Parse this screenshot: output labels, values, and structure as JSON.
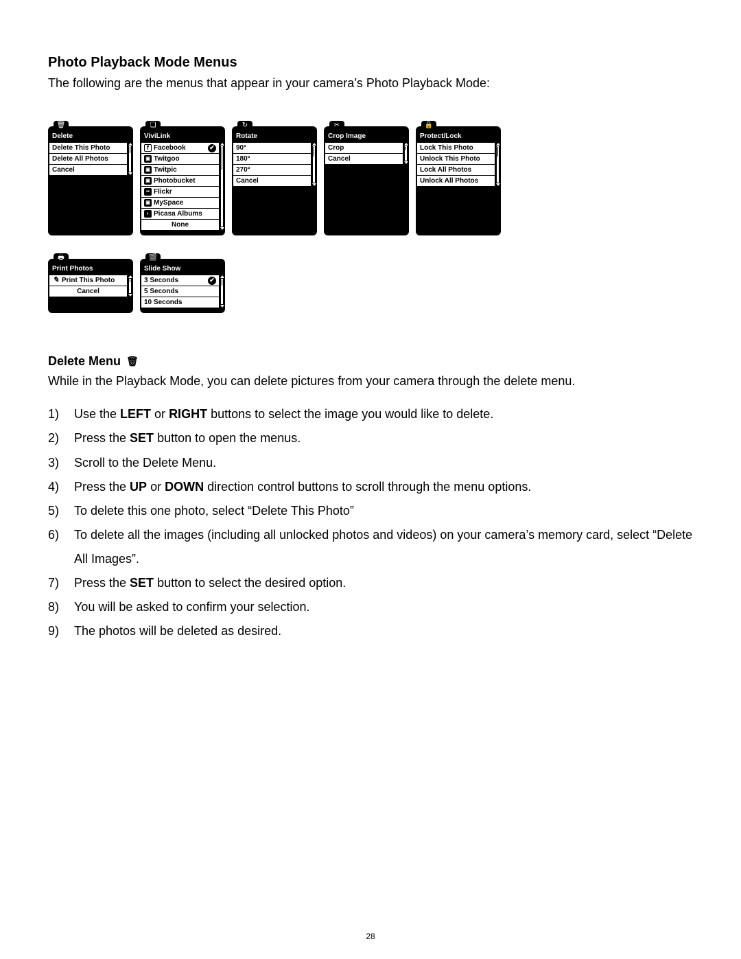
{
  "title": "Photo Playback Mode Menus",
  "intro": "The following are the menus that appear in your camera’s Photo Playback Mode:",
  "menus": {
    "delete": {
      "header": "Delete",
      "items": [
        "Delete This Photo",
        "Delete All Photos",
        "Cancel"
      ]
    },
    "vivilink": {
      "header": "ViviLink",
      "items": [
        "Facebook",
        "Twitgoo",
        "Twitpic",
        "Photobucket",
        "Flickr",
        "MySpace",
        "Picasa Albums",
        "None"
      ],
      "checked_index": 0
    },
    "rotate": {
      "header": "Rotate",
      "items": [
        "90°",
        "180°",
        "270°",
        "Cancel"
      ]
    },
    "crop": {
      "header": "Crop Image",
      "items": [
        "Crop",
        "Cancel"
      ]
    },
    "protect": {
      "header": "Protect/Lock",
      "items": [
        "Lock This Photo",
        "Unlock This Photo",
        "Lock All Photos",
        "Unlock All Photos"
      ]
    },
    "print": {
      "header": "Print Photos",
      "items": [
        "Print This Photo",
        "Cancel"
      ]
    },
    "slideshow": {
      "header": "Slide Show",
      "items": [
        "3 Seconds",
        "5 Seconds",
        "10 Seconds"
      ],
      "checked_index": 0
    }
  },
  "section": {
    "title": "Delete Menu",
    "desc": "While in the Playback Mode, you can delete pictures from your camera through the delete menu."
  },
  "step_nums": [
    "1)",
    "2)",
    "3)",
    "4)",
    "5)",
    "6)",
    "7)",
    "8)",
    "9)"
  ],
  "steps": {
    "s1_a": "Use the ",
    "s1_b1": "LEFT",
    "s1_c": " or ",
    "s1_b2": "RIGHT",
    "s1_d": " buttons to select the image you would like to delete.",
    "s2_a": "Press the ",
    "s2_b": "SET",
    "s2_c": " button to open the menus.",
    "s3": "Scroll to the Delete Menu.",
    "s4_a": "Press the ",
    "s4_b1": "UP",
    "s4_c": " or ",
    "s4_b2": "DOWN",
    "s4_d": " direction control buttons to scroll through the menu options.",
    "s5": "To delete this one photo, select “Delete This Photo”",
    "s6": "To delete all the images (including all unlocked photos and videos) on your camera’s memory card, select “Delete All Images”.",
    "s7_a": "Press the ",
    "s7_b": "SET",
    "s7_c": " button to select the desired option.",
    "s8": "You will be asked to confirm your selection.",
    "s9": "The photos will be deleted as desired."
  },
  "page_number": "28"
}
